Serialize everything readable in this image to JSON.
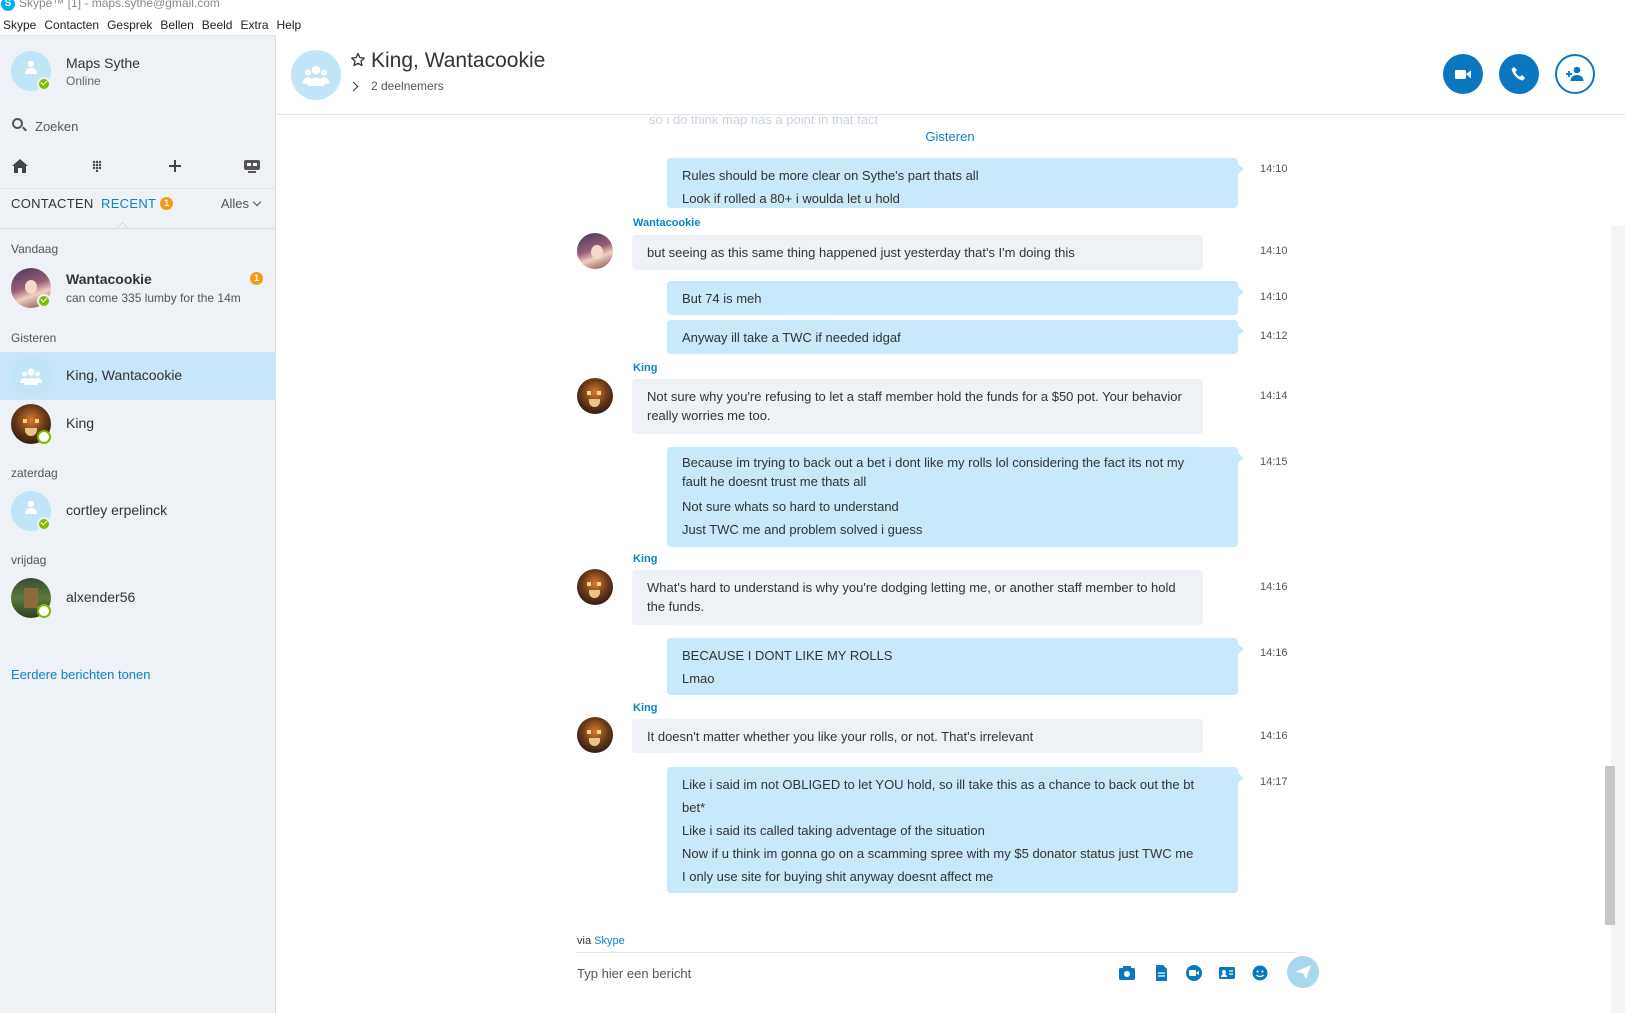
{
  "window": {
    "title": "Skype™ [1] - maps.sythe@gmail.com"
  },
  "menu": [
    "Skype",
    "Contacten",
    "Gesprek",
    "Bellen",
    "Beeld",
    "Extra",
    "Help"
  ],
  "profile": {
    "name": "Maps Sythe",
    "status": "Online"
  },
  "search": {
    "placeholder": "Zoeken"
  },
  "tabs": {
    "contacts": "CONTACTEN",
    "recent": "RECENT",
    "recent_badge": "1",
    "filter": "Alles"
  },
  "sections": {
    "today": "Vandaag",
    "yesterday": "Gisteren",
    "saturday": "zaterdag",
    "friday": "vrijdag"
  },
  "contacts": [
    {
      "name": "Wantacookie",
      "preview": "can come 335 lumby for the 14m",
      "badge": "1"
    },
    {
      "name": "King, Wantacookie"
    },
    {
      "name": "King"
    },
    {
      "name": "cortley erpelinck"
    },
    {
      "name": "alxender56"
    }
  ],
  "older_link": "Eerdere berichten tonen",
  "conversation": {
    "title": "King, Wantacookie",
    "participants": "2 deelnemers",
    "faded_previous": "so i do think map has a point in that fact",
    "day_separator": "Gisteren",
    "messages": [
      {
        "time": "14:10",
        "lines": [
          "Rules should be more clear on Sythe's part thats all",
          "Look if rolled a 80+ i woulda let u hold"
        ]
      },
      {
        "sender": "Wantacookie",
        "time": "14:10",
        "lines": [
          "but seeing as this same thing happened just yesterday that's I'm doing this"
        ]
      },
      {
        "time": "14:10",
        "lines": [
          "But 74 is meh"
        ]
      },
      {
        "time": "14:12",
        "lines": [
          "Anyway ill take a TWC if needed idgaf"
        ]
      },
      {
        "sender": "King",
        "time": "14:14",
        "lines": [
          "Not sure why you're refusing to let a staff member hold the funds for a $50 pot. Your behavior really worries me too."
        ]
      },
      {
        "time": "14:15",
        "lines": [
          "Because im trying to back out a bet i dont like my rolls lol considering the fact its not my",
          "fault he doesnt trust me thats all",
          "Not sure whats so hard to understand",
          "Just TWC me and problem solved i guess"
        ]
      },
      {
        "sender": "King",
        "time": "14:16",
        "lines": [
          "What's hard to understand is why you're dodging letting me, or another staff member to hold the funds."
        ]
      },
      {
        "time": "14:16",
        "lines": [
          "BECAUSE I DONT LIKE MY ROLLS",
          "Lmao"
        ]
      },
      {
        "sender": "King",
        "time": "14:16",
        "lines": [
          "It doesn't matter whether you like your rolls, or not. That's irrelevant"
        ]
      },
      {
        "time": "14:17",
        "lines": [
          "Like i said im not OBLIGED to let YOU hold, so ill take this as a chance to back out the bt",
          "bet*",
          "Like i said its called taking adventage of the situation",
          "Now if u think im gonna go on a scamming spree with my $5 donator status just TWC me",
          "I only use site for buying shit anyway doesnt affect me"
        ]
      }
    ]
  },
  "compose": {
    "via_prefix": "via",
    "via_app": "Skype",
    "placeholder": "Typ hier een bericht"
  },
  "colors": {
    "accent": "#0a78bf",
    "outgoing_bubble": "#c7e9f9",
    "incoming_bubble": "#eef1f5",
    "sidebar": "#eef1f5",
    "badge": "#f29b1a",
    "online": "#7fba00"
  },
  "icons": [
    "home-icon",
    "dialpad-icon",
    "plus-icon",
    "bot-icon",
    "search-icon",
    "star-icon",
    "video-call-icon",
    "phone-icon",
    "add-person-icon",
    "send-icon"
  ]
}
